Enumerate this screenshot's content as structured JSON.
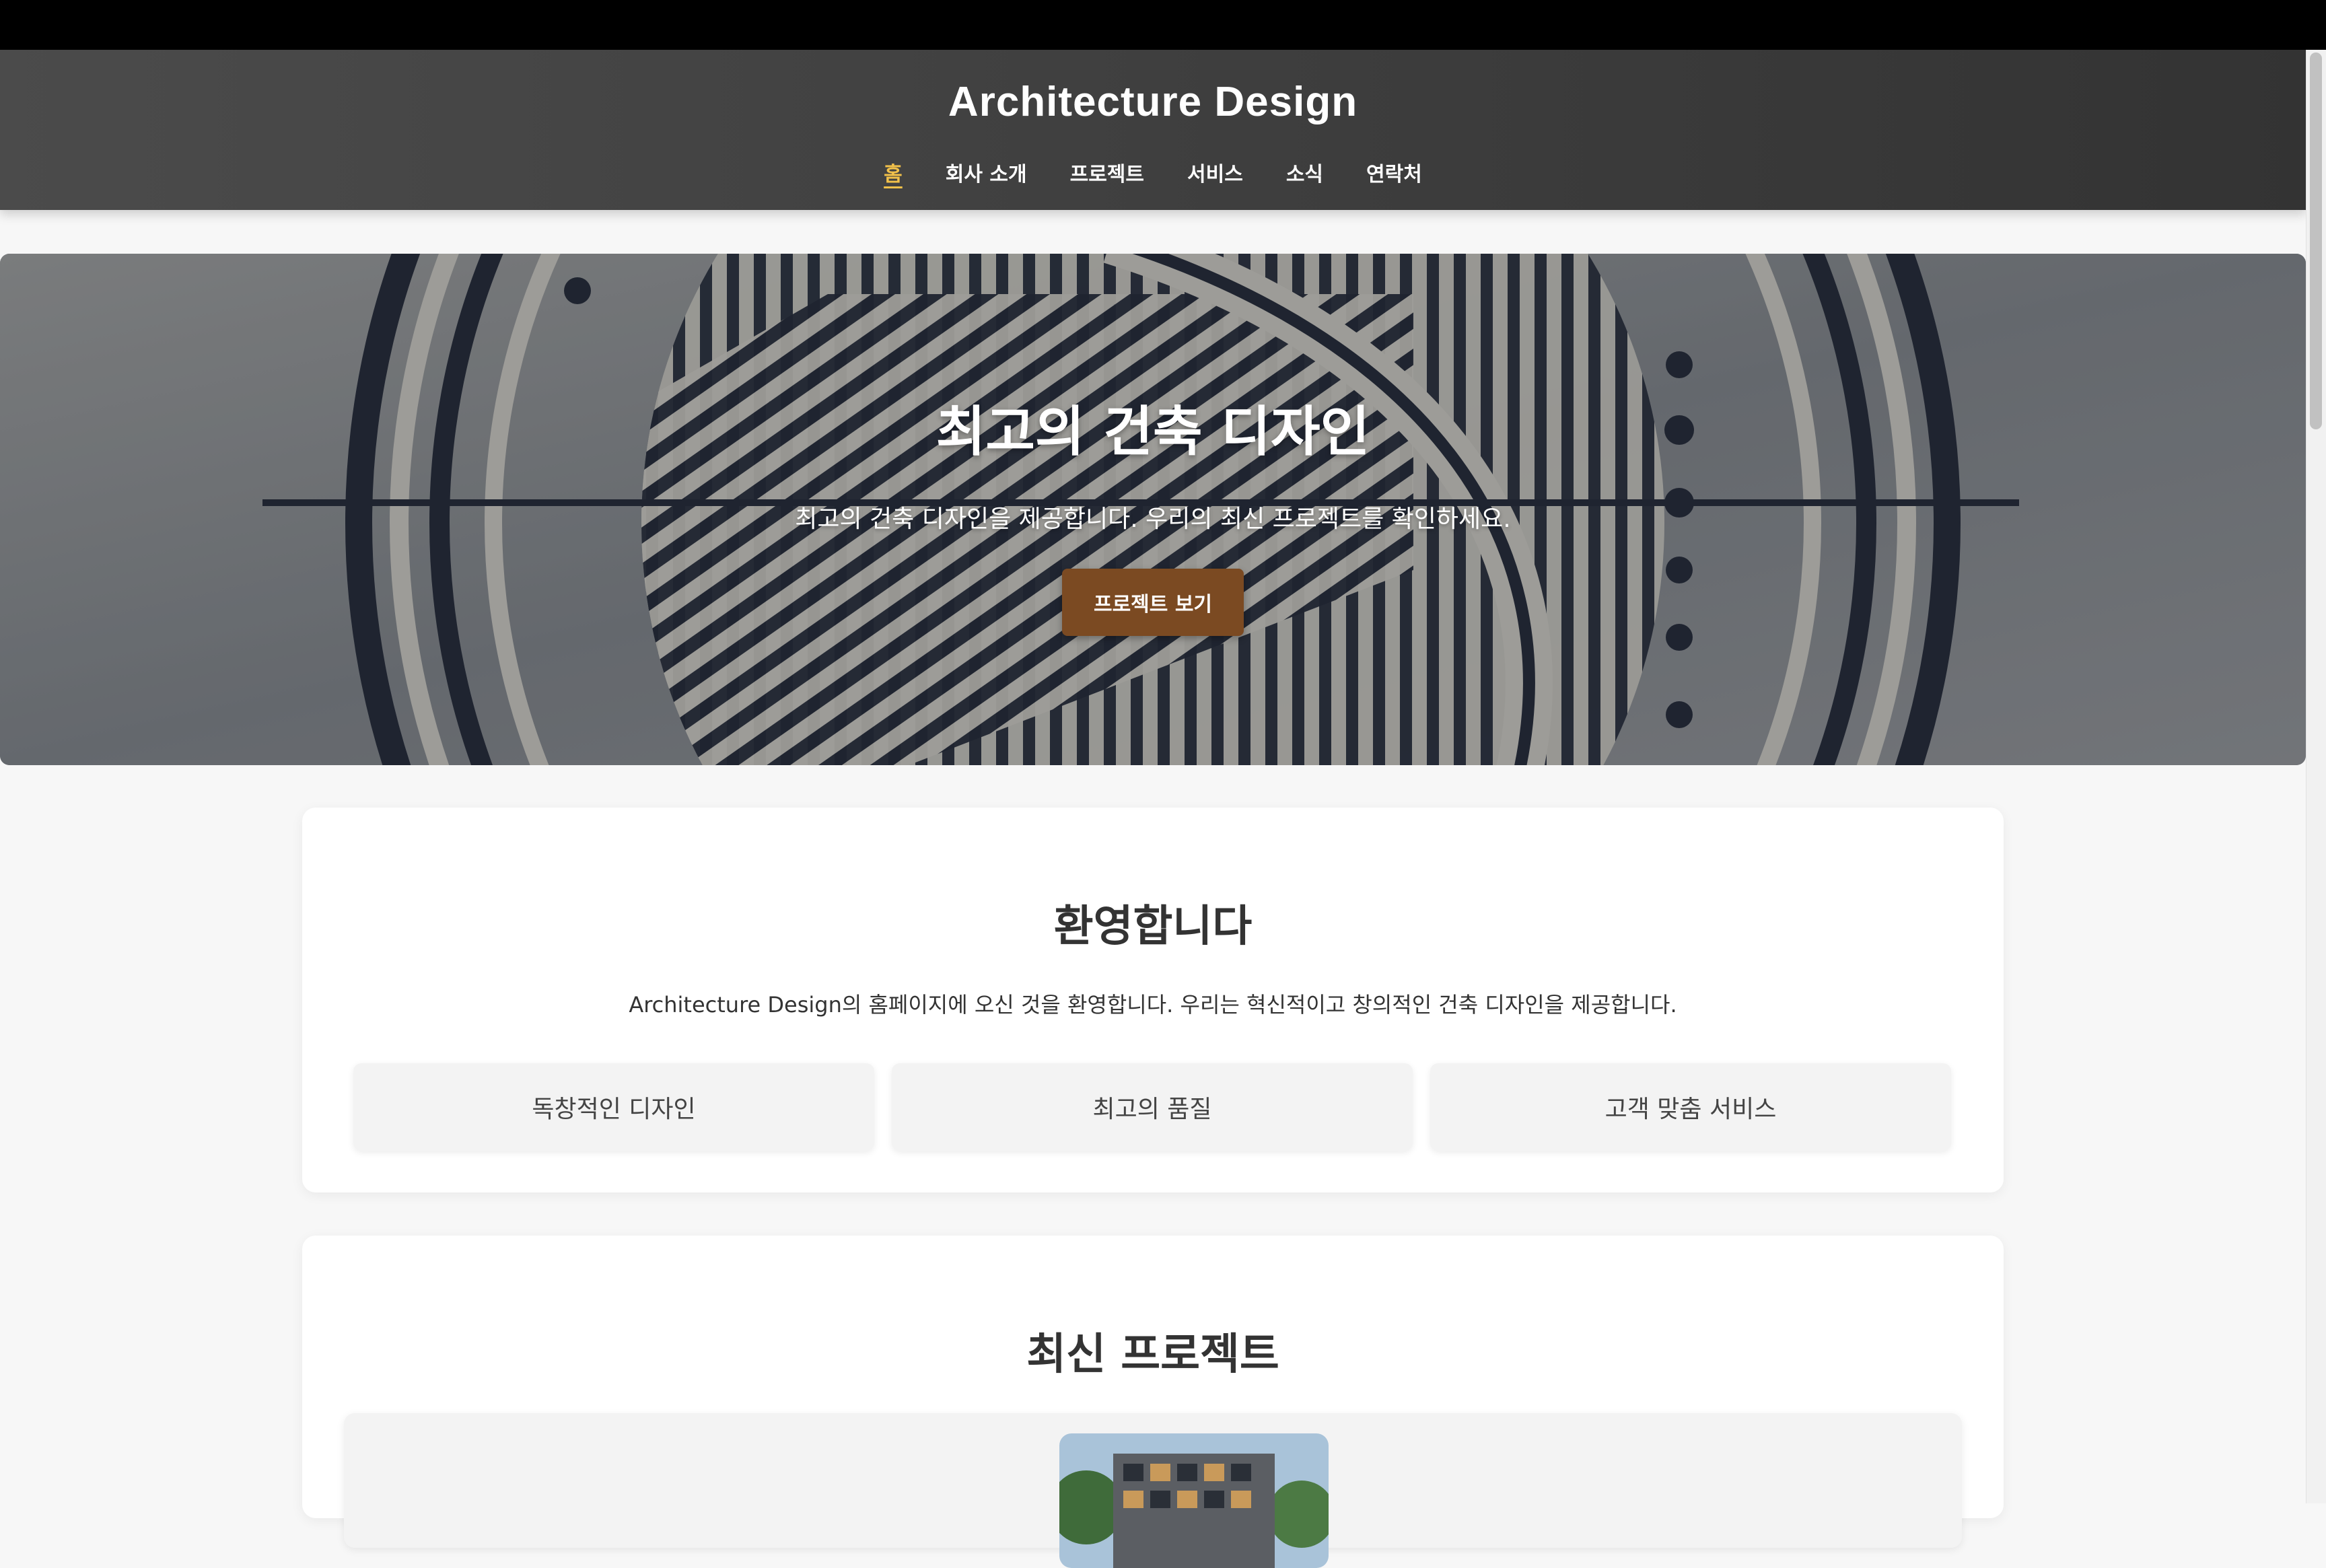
{
  "header": {
    "title": "Architecture Design",
    "nav": [
      {
        "label": "홈",
        "active": true
      },
      {
        "label": "회사 소개",
        "active": false
      },
      {
        "label": "프로젝트",
        "active": false
      },
      {
        "label": "서비스",
        "active": false
      },
      {
        "label": "소식",
        "active": false
      },
      {
        "label": "연락처",
        "active": false
      }
    ]
  },
  "hero": {
    "title": "최고의 건축 디자인",
    "subtitle": "최고의 건축 디자인을 제공합니다. 우리의 최신 프로젝트를 확인하세요.",
    "button_label": "프로젝트 보기"
  },
  "welcome": {
    "heading": "환영합니다",
    "text": "Architecture Design의 홈페이지에 오신 것을 환영합니다. 우리는 혁신적이고 창의적인 건축 디자인을 제공합니다.",
    "features": [
      "독창적인 디자인",
      "최고의 품질",
      "고객 맞춤 서비스"
    ]
  },
  "projects": {
    "heading": "최신 프로젝트"
  },
  "colors": {
    "accent": "#f2c14a",
    "button": "#7b4a22",
    "header_bg": "#3f3f3f"
  }
}
